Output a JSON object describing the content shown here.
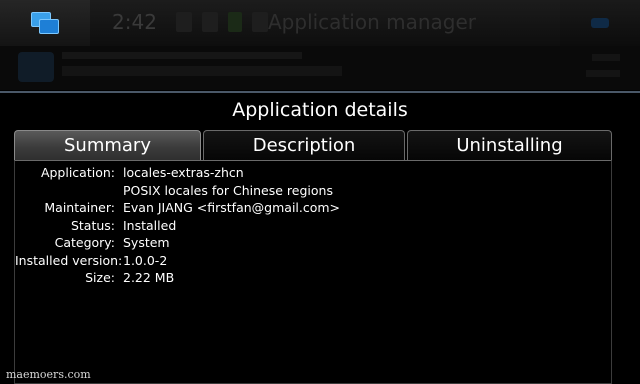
{
  "statusbar": {
    "clock": "2:42",
    "app_title": "Application manager"
  },
  "dialog": {
    "title": "Application details",
    "tabs": [
      {
        "label": "Summary",
        "active": true
      },
      {
        "label": "Description",
        "active": false
      },
      {
        "label": "Uninstalling",
        "active": false
      }
    ],
    "details": [
      {
        "label": "Application:",
        "value": "locales-extras-zhcn"
      },
      {
        "label": "",
        "value": "POSIX locales for Chinese regions"
      },
      {
        "label": "Maintainer:",
        "value": "Evan JIANG <firstfan@gmail.com>"
      },
      {
        "label": "Status:",
        "value": "Installed"
      },
      {
        "label": "Category:",
        "value": "System"
      },
      {
        "label": "Installed version:",
        "value": "1.0.0-2"
      },
      {
        "label": "Size:",
        "value": "2.22 MB"
      }
    ]
  },
  "watermark": "maemoers.com",
  "icons": {
    "task_switcher": "task-switcher-icon",
    "menu": "menu-icon"
  },
  "colors": {
    "accent": "#3aa0ea",
    "dialog_border": "#4a5868"
  }
}
